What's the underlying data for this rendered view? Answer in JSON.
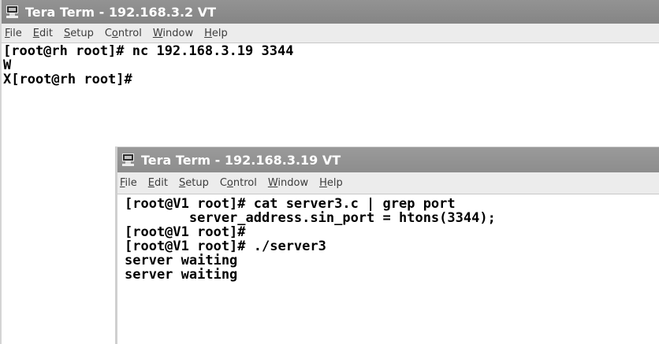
{
  "back_window": {
    "title": "Tera Term - 192.168.3.2 VT",
    "menu": [
      {
        "label": "File",
        "underline": "F"
      },
      {
        "label": "Edit",
        "underline": "E"
      },
      {
        "label": "Setup",
        "underline": "S"
      },
      {
        "label": "Control",
        "underline": "o"
      },
      {
        "label": "Window",
        "underline": "W"
      },
      {
        "label": "Help",
        "underline": "H"
      }
    ],
    "lines": [
      "[root@rh root]# nc 192.168.3.19 3344",
      "W",
      "X[root@rh root]#"
    ]
  },
  "front_window": {
    "title": "Tera Term - 192.168.3.19 VT",
    "menu": [
      {
        "label": "File",
        "underline": "F"
      },
      {
        "label": "Edit",
        "underline": "E"
      },
      {
        "label": "Setup",
        "underline": "S"
      },
      {
        "label": "Control",
        "underline": "o"
      },
      {
        "label": "Window",
        "underline": "W"
      },
      {
        "label": "Help",
        "underline": "H"
      }
    ],
    "lines": [
      "[root@V1 root]# cat server3.c | grep port",
      "        server_address.sin_port = htons(3344);",
      "[root@V1 root]#",
      "[root@V1 root]# ./server3",
      "server waiting",
      "server waiting"
    ]
  },
  "colors": {
    "titlebar": "#8c8c8c",
    "title_text": "#ffffff",
    "menubar": "#ececec",
    "terminal_bg": "#ffffff",
    "terminal_text": "#000000"
  },
  "icons": {
    "app_icon": "terminal-monitor-icon"
  }
}
